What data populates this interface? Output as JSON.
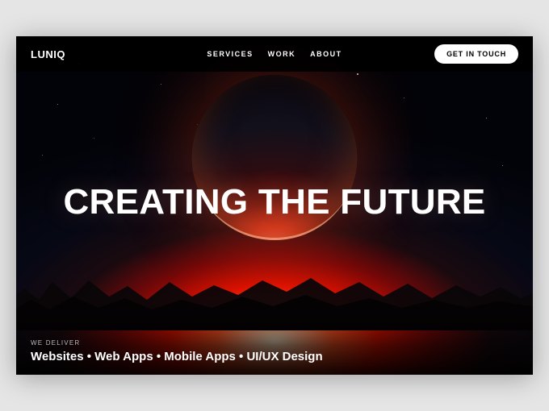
{
  "nav": {
    "logo": "LUNIQ",
    "links": [
      "SERVICES",
      "WORK",
      "ABOUT"
    ],
    "cta": "GET IN TOUCH"
  },
  "hero": {
    "headline": "CREATING THE FUTURE"
  },
  "deliver": {
    "label": "WE DELIVER",
    "items": "Websites • Web Apps • Mobile Apps • UI/UX Design"
  },
  "colors": {
    "accent": "#ff4422",
    "bg": "#000000",
    "text": "#ffffff"
  }
}
